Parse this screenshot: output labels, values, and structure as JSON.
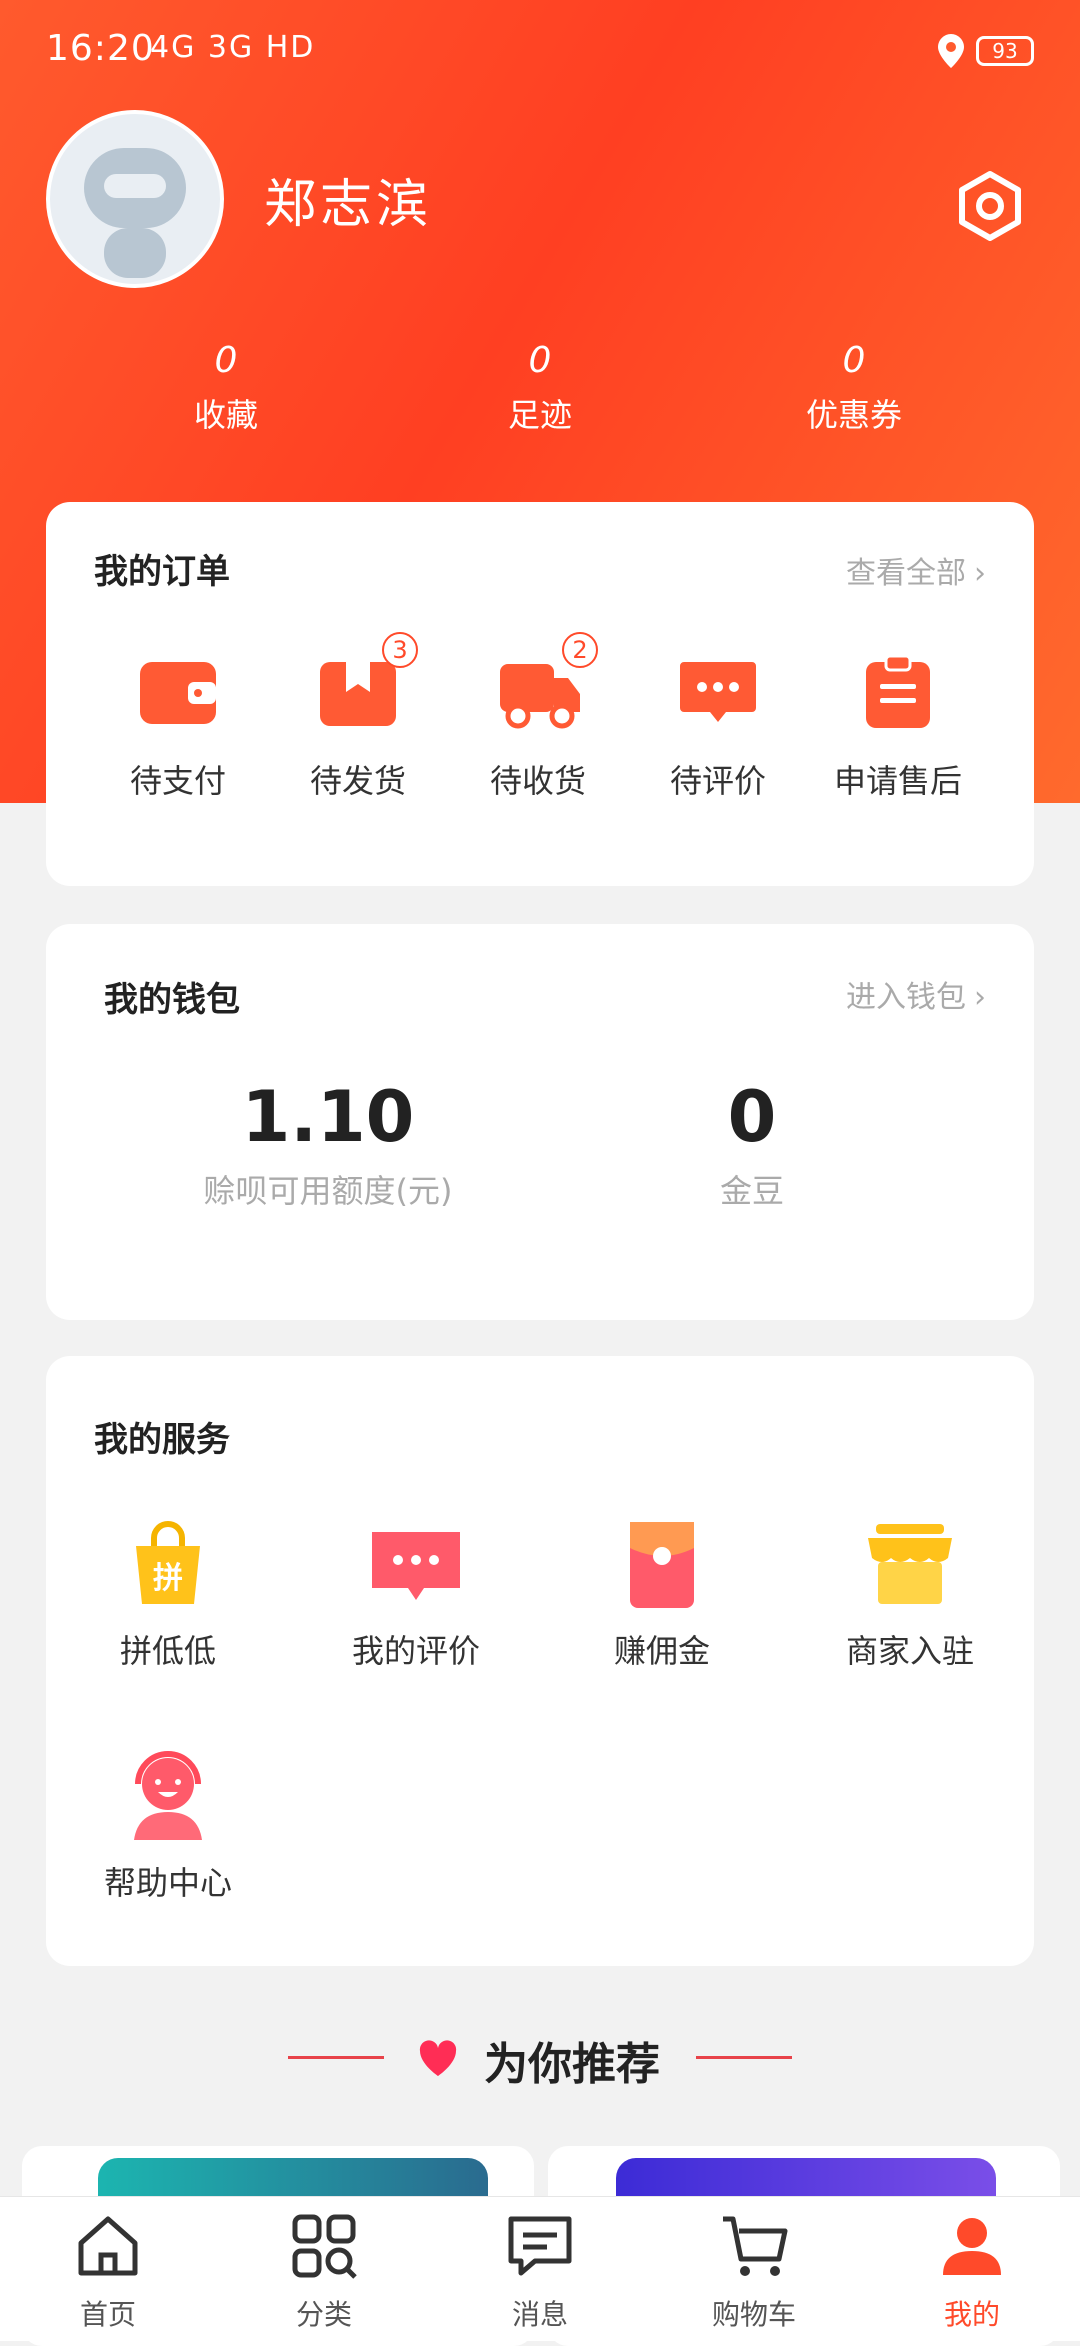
{
  "status_bar": {
    "time": "16:20",
    "network": "4G 3G HD",
    "battery": "93"
  },
  "profile": {
    "username": "郑志滨"
  },
  "stats": [
    {
      "value": "0",
      "label": "收藏"
    },
    {
      "value": "0",
      "label": "足迹"
    },
    {
      "value": "0",
      "label": "优惠券"
    }
  ],
  "orders": {
    "title": "我的订单",
    "view_all": "查看全部",
    "items": [
      {
        "label": "待支付",
        "icon": "wallet-icon"
      },
      {
        "label": "待发货",
        "icon": "box-icon",
        "badge": "3"
      },
      {
        "label": "待收货",
        "icon": "truck-icon",
        "badge": "2"
      },
      {
        "label": "待评价",
        "icon": "chat-icon"
      },
      {
        "label": "申请售后",
        "icon": "clipboard-icon"
      }
    ]
  },
  "wallet": {
    "title": "我的钱包",
    "enter": "进入钱包",
    "items": [
      {
        "value": "1.10",
        "label": "赊呗可用额度(元)"
      },
      {
        "value": "0",
        "label": "金豆"
      }
    ]
  },
  "services": {
    "title": "我的服务",
    "items": [
      {
        "label": "拼低低",
        "icon": "shopping-bag-icon"
      },
      {
        "label": "我的评价",
        "icon": "review-chat-icon"
      },
      {
        "label": "赚佣金",
        "icon": "red-envelope-icon"
      },
      {
        "label": "商家入驻",
        "icon": "store-icon"
      },
      {
        "label": "帮助中心",
        "icon": "customer-service-icon"
      }
    ]
  },
  "recommend": {
    "title": "为你推荐"
  },
  "tabbar": {
    "items": [
      {
        "label": "首页",
        "icon": "home-icon"
      },
      {
        "label": "分类",
        "icon": "category-icon"
      },
      {
        "label": "消息",
        "icon": "message-icon"
      },
      {
        "label": "购物车",
        "icon": "cart-icon"
      },
      {
        "label": "我的",
        "icon": "profile-icon",
        "active": true
      }
    ]
  },
  "colors": {
    "brand": "#ff4a2a",
    "background": "#f2f2f2"
  }
}
